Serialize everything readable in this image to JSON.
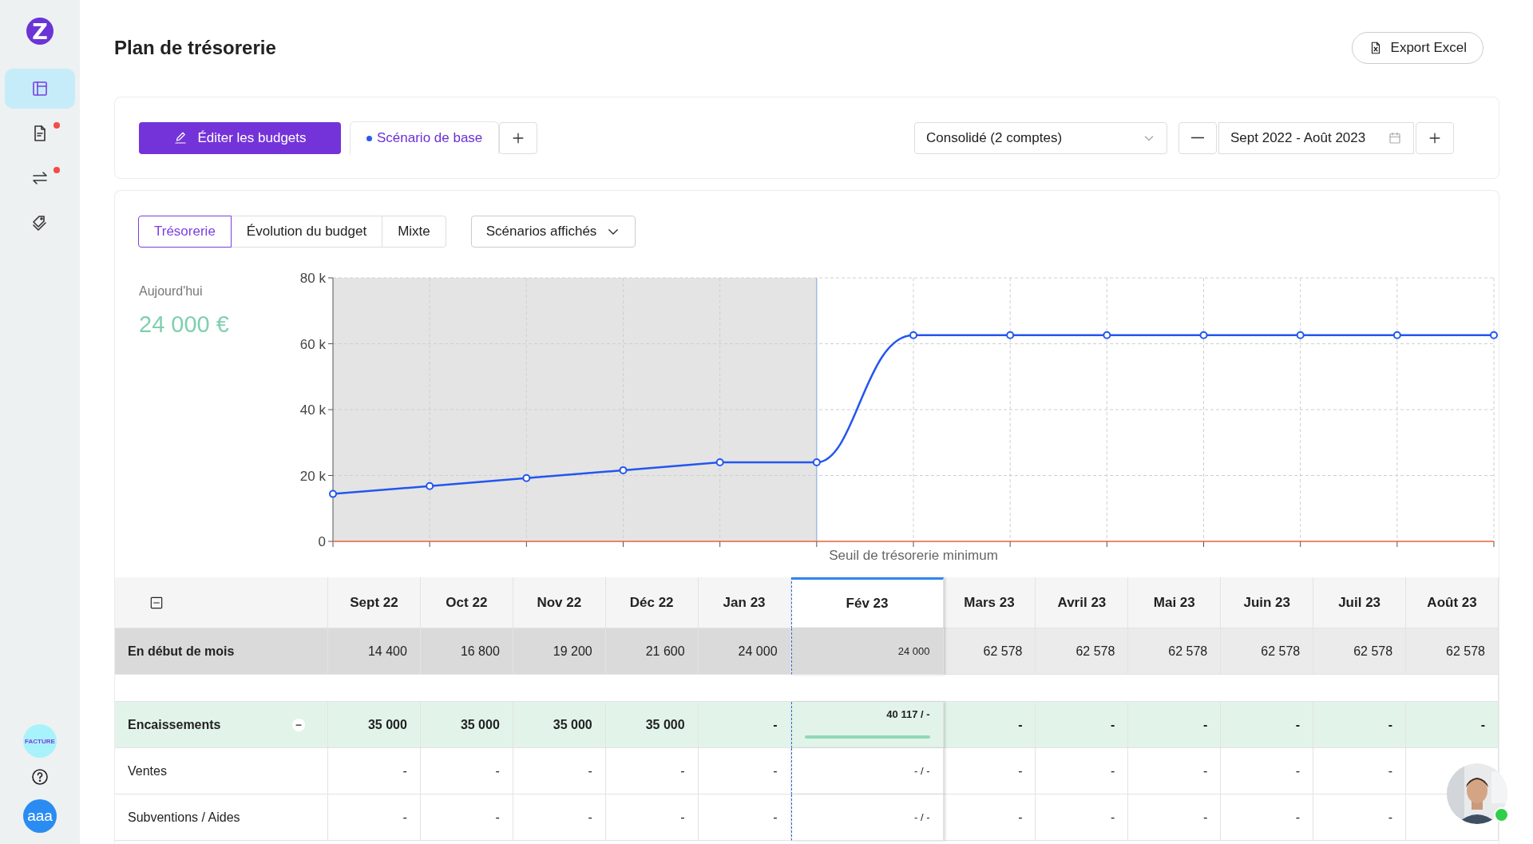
{
  "sidebar": {
    "logo": "Z",
    "nav": [
      {
        "kind": "layout",
        "selected": true,
        "notification": false
      },
      {
        "kind": "document",
        "selected": false,
        "notification": true
      },
      {
        "kind": "transfer",
        "selected": false,
        "notification": true
      },
      {
        "kind": "tags",
        "selected": false,
        "notification": false
      }
    ],
    "invoice_badge": "FACTURE",
    "user_avatar": "aaa"
  },
  "header": {
    "title": "Plan de trésorerie",
    "export_button": "Export Excel"
  },
  "toolbar": {
    "edit_button": "Éditer les budgets",
    "scenarios": [
      {
        "label": "Scénario de base",
        "selected": true
      }
    ],
    "account_select": "Consolidé (2 comptes)",
    "period": "Sept 2022 - Août 2023"
  },
  "view_tabs": [
    {
      "label": "Trésorerie",
      "selected": true
    },
    {
      "label": "Évolution du budget",
      "selected": false
    },
    {
      "label": "Mixte",
      "selected": false
    }
  ],
  "scenario_dropdown": "Scénarios affichés",
  "today": {
    "label": "Aujourd'hui",
    "value": "24 000 €"
  },
  "chart_data": {
    "type": "line",
    "ylim": [
      0,
      80000
    ],
    "yticks": [
      {
        "value": 0,
        "label": "0"
      },
      {
        "value": 20000,
        "label": "20 k"
      },
      {
        "value": 40000,
        "label": "40 k"
      },
      {
        "value": 60000,
        "label": "60 k"
      },
      {
        "value": 80000,
        "label": "80 k"
      }
    ],
    "grid": true,
    "series": [
      {
        "color": "#2356f0",
        "marker": "circle",
        "values": [
          14400,
          16800,
          19200,
          21600,
          24000,
          24000,
          62600,
          62600,
          62600,
          62600,
          62600,
          62600,
          62600
        ]
      }
    ],
    "ref_lines": [
      {
        "label": "Seuil de trésorerie minimum",
        "color": "#e8603c"
      }
    ]
  },
  "table": {
    "columns": [
      {
        "label": "Sept 22",
        "past": true,
        "selected": false
      },
      {
        "label": "Oct 22",
        "past": true,
        "selected": false
      },
      {
        "label": "Nov 22",
        "past": true,
        "selected": false
      },
      {
        "label": "Déc 22",
        "past": true,
        "selected": false
      },
      {
        "label": "Jan 23",
        "past": true,
        "selected": false
      },
      {
        "label": "Fév 23",
        "past": true,
        "selected": true
      },
      {
        "label": "Mars 23",
        "past": false,
        "selected": false
      },
      {
        "label": "Avril 23",
        "past": false,
        "selected": false
      },
      {
        "label": "Mai 23",
        "past": false,
        "selected": false
      },
      {
        "label": "Juin 23",
        "past": false,
        "selected": false
      },
      {
        "label": "Juil 23",
        "past": false,
        "selected": false
      },
      {
        "label": "Août 23",
        "past": false,
        "selected": false
      }
    ],
    "rows": [
      {
        "kind": "balance",
        "label": "En début de mois",
        "cells": [
          {
            "text": "14 400"
          },
          {
            "text": "16 800"
          },
          {
            "text": "19 200"
          },
          {
            "text": "21 600"
          },
          {
            "text": "24 000"
          },
          {
            "text": "24 000"
          },
          {
            "text": "62 578"
          },
          {
            "text": "62 578"
          },
          {
            "text": "62 578"
          },
          {
            "text": "62 578"
          },
          {
            "text": "62 578"
          },
          {
            "text": "62 578"
          }
        ]
      },
      {
        "kind": "spacer"
      },
      {
        "kind": "category",
        "label": "Encaissements",
        "expanded": true,
        "cells": [
          {
            "text": "35 000"
          },
          {
            "text": "35 000"
          },
          {
            "text": "35 000"
          },
          {
            "text": "35 000"
          },
          {
            "text": "-"
          },
          {
            "text": "40 117 / -",
            "level": 1
          },
          {
            "text": "-"
          },
          {
            "text": "-"
          },
          {
            "text": "-"
          },
          {
            "text": "-"
          },
          {
            "text": "-"
          },
          {
            "text": "-"
          }
        ]
      },
      {
        "kind": "item",
        "label": "Ventes",
        "cells": [
          {
            "text": "-"
          },
          {
            "text": "-"
          },
          {
            "text": "-"
          },
          {
            "text": "-"
          },
          {
            "text": "-"
          },
          {
            "text": "- / -"
          },
          {
            "text": "-"
          },
          {
            "text": "-"
          },
          {
            "text": "-"
          },
          {
            "text": "-"
          },
          {
            "text": "-"
          }
        ]
      },
      {
        "kind": "item",
        "label": "Subventions / Aides",
        "cells": [
          {
            "text": "-"
          },
          {
            "text": "-"
          },
          {
            "text": "-"
          },
          {
            "text": "-"
          },
          {
            "text": "-"
          },
          {
            "text": "- / -"
          },
          {
            "text": "-"
          },
          {
            "text": "-"
          },
          {
            "text": "-"
          },
          {
            "text": "-"
          },
          {
            "text": "-"
          }
        ]
      }
    ]
  }
}
